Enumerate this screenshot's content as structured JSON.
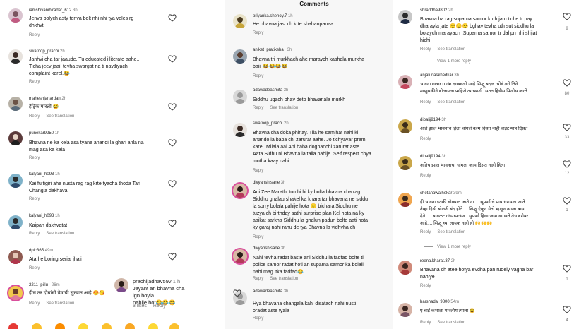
{
  "colors": {
    "heart": "#3a3a3a",
    "meta": "#777777",
    "text": "#111111"
  },
  "panel2": {
    "title": "Comments"
  },
  "left_comments": [
    {
      "user": "iamshivanibiradar_612",
      "time": "3h",
      "text": [
        "Jenva bolych asty tenva bolt nhi nhi tya veles rg",
        "dhkhvti"
      ],
      "actions": [
        "Reply"
      ],
      "likes": ""
    },
    {
      "user": "swaroop_prachi",
      "time": "2h",
      "text": [
        "Janhvi cha tar jaaude. Tu educated illiterate aahe...",
        "Ticha jeev jaail tevha swargat na ti navtliyachi",
        "complaint karel.😂"
      ],
      "actions": [
        "Reply"
      ],
      "likes": ""
    },
    {
      "user": "maheshjanardan",
      "time": "2h",
      "text": [
        "हेंट्रिक मारली 😂"
      ],
      "actions": [
        "Reply",
        "See translation"
      ],
      "likes": ""
    },
    {
      "user": "punekar9250",
      "time": "1h",
      "text": [
        "Bhavna ne ka kela asa tyane anandi la ghari anla na",
        "mag asa ka kela"
      ],
      "actions": [
        "Reply"
      ],
      "likes": ""
    },
    {
      "user": "kalyani_h093",
      "time": "1h",
      "text": [
        "Kai fultigiri ahe nusta rag rag krte tyacha thoda Tari",
        "Changla dakhava"
      ],
      "actions": [
        "Reply"
      ],
      "likes": ""
    },
    {
      "user": "kalyani_h093",
      "time": "1h",
      "text": [
        "Kaipan dakhvatat"
      ],
      "actions": [
        "Reply",
        "See translation"
      ],
      "likes": ""
    },
    {
      "user": "dpic365",
      "time": "49m",
      "text": [
        "Ata he boring serial jhali"
      ],
      "actions": [
        "Reply"
      ],
      "likes": ""
    },
    {
      "user": "2211_pillu_",
      "time": "26m",
      "text": [
        "हीच तर दोघांची प्रेमाची सुरवात आहे 😍😘"
      ],
      "actions": [
        "Reply",
        "See translation"
      ],
      "likes": ""
    }
  ],
  "overlay_comment": {
    "user": "prachijadhav59v",
    "time": "1 h",
    "text": [
      "Jayant an bhavna cha lgn hoyla",
      "pahije hot😂😂😂"
    ],
    "actions": [
      "3 likes",
      "Reply"
    ]
  },
  "middle_comments": [
    {
      "user": "priyanka.shenoy.7",
      "time": "1h",
      "text": [
        "He bhavna jast ch krte shahanpanaa"
      ],
      "actions": [
        "Reply"
      ]
    },
    {
      "user": "aniket_pratiksha_",
      "time": "3h",
      "text": [
        "Bhavna tri murkhach ahe maraych kashala murkha",
        "baiii 😂😂😂😂"
      ],
      "actions": [
        "Reply"
      ]
    },
    {
      "user": "adawadeasmita",
      "time": "3h",
      "text": [
        "Siddhu ugach bhav deto bhavanala murkh"
      ],
      "actions": [
        "Reply",
        "See translation"
      ]
    },
    {
      "user": "swaroop_prachi",
      "time": "2h",
      "text": [
        "Bhavna cha doka phirlay. Tila he samjhat nahi ki",
        "anando la baba chi zarurat aahe. Jo tichyavar prem",
        "karel. Milala aai Ani baba doghanchi zarurat aste.",
        "Aata Sidhu ni Bhavna la talla pahije. Self respect chya",
        "motha kaay nahi"
      ],
      "actions": [
        "Reply"
      ]
    },
    {
      "user": "divyanshisane",
      "time": "3h",
      "text": [
        "Ani Zee Marathi tumhi hi ky bolta bhavna cha rag",
        "Siddhu ghalau shakel ka khara tar bhavana ne siddu",
        "la sorry bolala pahije hota 🙂 bichara Siddhu ne",
        "tuzya ch birthday sathi surprise plan Kel hota na ky",
        "aaikat sarkha Siddhu la ghalun padun bolte aati hota",
        "ky garaj nahi rahu de tya Bhavna la vidhvha ch"
      ],
      "actions": [
        "Reply"
      ]
    },
    {
      "user": "divyanshisane",
      "time": "3h",
      "text": [
        "Nahi tevha radat baste ani Siddhu la fadfad bolte ti",
        "police samor radat hoti an suparna samor ka bolali",
        "nahi mag itka fadfad😂"
      ],
      "actions": [
        "Reply",
        "See translation"
      ]
    },
    {
      "user": "adawadeasmita",
      "time": "3h",
      "text": [
        "Hya bhavana changala kahi disatach nahi nusti",
        "oradat aste tyala"
      ],
      "actions": [
        "Reply"
      ]
    }
  ],
  "right_comments": [
    {
      "user": "shraddha9802",
      "time": "2h",
      "text": [
        "Bhavna ha rag suparna samor kuth jato tiche tr pay",
        "dharayla jate 😒😒😒 bghav tevha uth sut siddhu la",
        "bolaych marayach .Suparna samor tr dal pn nhi shijat",
        "hichi"
      ],
      "actions": [
        "Reply",
        "See translation"
      ],
      "likes": "9",
      "more": "View 1 more reply"
    },
    {
      "user": "anjali.daskhedkar",
      "time": "3h",
      "text": [
        "भावना over rude दाखवली आहे सिद्धू बदल. चोडं तरी तिने",
        "माणुसकीने बोलायला पाहिजे त्याच्याशी. सतत हिडीस फिडीस करते."
      ],
      "actions": [
        "Reply",
        "See translation"
      ],
      "likes": "80",
      "more": ""
    },
    {
      "user": "dipalij9194",
      "time": "3h",
      "text": [
        "अति झालं भावनाच हिला चांगलं काम दिसत नाही वाईट मात्र दिसतं"
      ],
      "actions": [
        "Reply"
      ],
      "likes": "33",
      "more": ""
    },
    {
      "user": "dipalij9194",
      "time": "3h",
      "text": [
        "अतिच झाल भावनाचा चांगला काम दिसत नाही हिला"
      ],
      "actions": [
        "Reply"
      ],
      "likes": "12",
      "more": ""
    },
    {
      "user": "chetanawalhekar",
      "time": "39m",
      "text": [
        "ही भावना इतकी डोक्यात जाते ना.... सुपर्णा चे पाय धरायला जाते....",
        "तेव्हा हिची बोलती बंद होते.... सिद्धू ऐकून घेतो म्हणून त्याला त्रास",
        "देते..... बावळट character.. सुपर्णा हिला जसा वागवते तेच बरोबर",
        "आहे.....सिद्धू च्या लायक नाही ही 🙌🙌🙌"
      ],
      "actions": [
        "Reply",
        "See translation"
      ],
      "likes": "1",
      "more": "View 1 more reply"
    },
    {
      "user": "reena.kharat.37",
      "time": "2h",
      "text": [
        "Bhavana ch atee hotya evdha pan rudely vagna bar",
        "nahiye"
      ],
      "actions": [
        "Reply"
      ],
      "likes": "1",
      "more": ""
    },
    {
      "user": "harshada_9800",
      "time": "54m",
      "text": [
        "ए बाई कशाला मारलीय त्याला 😂"
      ],
      "actions": [
        "Reply",
        "See translation"
      ],
      "likes": "4",
      "more": ""
    }
  ],
  "reaction_icons": [
    "heart-emoji-icon",
    "tears-of-joy-emoji-icon",
    "fire-emoji-icon",
    "clap-emoji-icon",
    "grin-emoji-icon",
    "heart-eyes-emoji-icon",
    "wow-emoji-icon",
    "laugh-emoji-icon"
  ]
}
